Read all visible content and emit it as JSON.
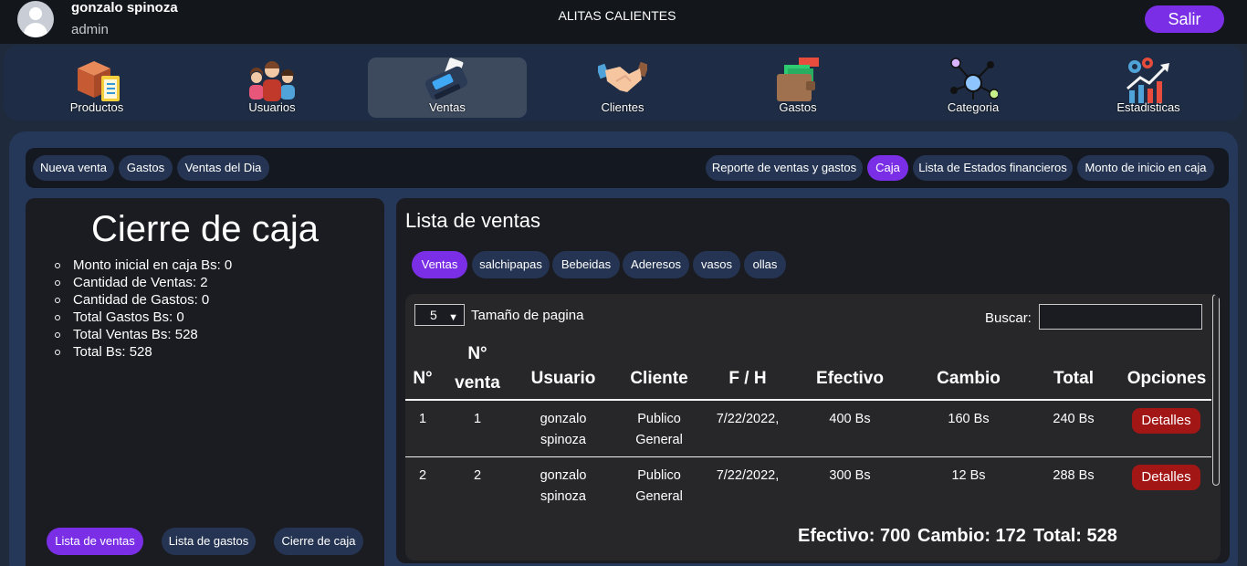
{
  "user": {
    "name": "gonzalo spinoza",
    "role": "admin"
  },
  "app_title": "ALITAS CALIENTES",
  "logout_label": "Salir",
  "main_nav": [
    {
      "label": "Productos",
      "icon": "box-clipboard-icon"
    },
    {
      "label": "Usuarios",
      "icon": "users-group-icon"
    },
    {
      "label": "Ventas",
      "icon": "card-terminal-icon",
      "active": true
    },
    {
      "label": "Clientes",
      "icon": "handshake-icon"
    },
    {
      "label": "Gastos",
      "icon": "wallet-cash-icon"
    },
    {
      "label": "Categoria",
      "icon": "network-nodes-icon"
    },
    {
      "label": "Estadisticas",
      "icon": "gears-chart-icon"
    }
  ],
  "sub_nav_left": [
    "Nueva venta",
    "Gastos",
    "Ventas del Dia"
  ],
  "sub_nav_right": [
    "Reporte de ventas y gastos",
    "Caja",
    "Lista de Estados financieros",
    "Monto de inicio en caja"
  ],
  "sub_nav_active": "Caja",
  "cierre": {
    "title": "Cierre de caja",
    "stats": [
      "Monto inicial en caja Bs: 0",
      "Cantidad de Ventas: 2",
      "Cantidad de Gastos: 0",
      "Total Gastos Bs: 0",
      "Total Ventas Bs: 528",
      "Total Bs: 528"
    ],
    "buttons": [
      "Lista de ventas",
      "Lista de gastos",
      "Cierre de caja"
    ]
  },
  "ventas": {
    "title": "Lista de ventas",
    "categories": [
      "Ventas",
      "salchipapas",
      "Bebeidas",
      "Aderesos",
      "vasos",
      "ollas"
    ],
    "page_size": "5",
    "page_size_label": "Tamaño de pagina",
    "search_label": "Buscar:",
    "search_value": "",
    "columns": [
      "N°",
      "N° venta",
      "Usuario",
      "Cliente",
      "F / H",
      "Efectivo",
      "Cambio",
      "Total",
      "Opciones"
    ],
    "rows": [
      {
        "n": "1",
        "venta": "1",
        "usuario": "gonzalo spinoza",
        "cliente": "Publico General",
        "fecha": "7/22/2022,",
        "efectivo": "400 Bs",
        "cambio": "160 Bs",
        "total": "240 Bs",
        "accion": "Detalles"
      },
      {
        "n": "2",
        "venta": "2",
        "usuario": "gonzalo spinoza",
        "cliente": "Publico General",
        "fecha": "7/22/2022,",
        "efectivo": "300 Bs",
        "cambio": "12 Bs",
        "total": "288 Bs",
        "accion": "Detalles"
      }
    ],
    "totals": {
      "efectivo": "Efectivo: 700",
      "cambio": "Cambio: 172",
      "total": "Total: 528"
    }
  },
  "colors": {
    "accent": "#7a2fe6",
    "danger": "#a31616",
    "panel": "#25385a",
    "nav": "#1e2d45"
  }
}
